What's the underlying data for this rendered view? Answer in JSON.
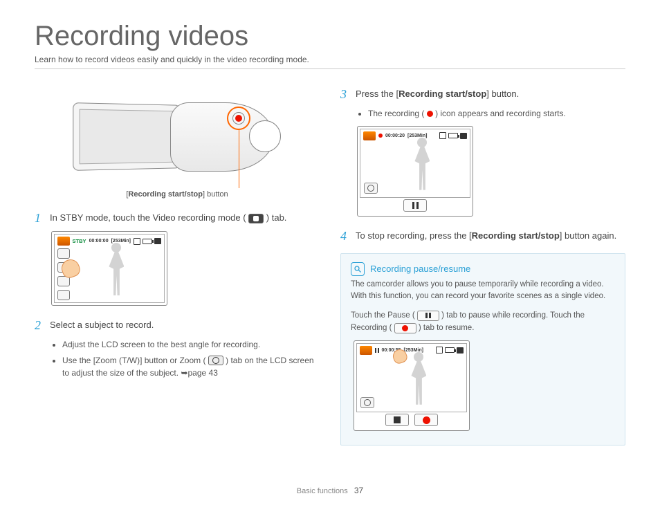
{
  "header": {
    "title": "Recording videos",
    "subtitle": "Learn how to record videos easily and quickly in the video recording mode."
  },
  "camcorder_caption": {
    "prefix": "[",
    "label": "Recording start/stop",
    "suffix": "] button"
  },
  "steps": {
    "s1": {
      "num": "1",
      "text_before": "In STBY mode, touch the Video recording mode (",
      "text_after": ") tab."
    },
    "s2": {
      "num": "2",
      "text": "Select a subject to record."
    },
    "s2_bullets": {
      "b1": "Adjust the LCD screen to the best angle for recording.",
      "b2_a": "Use the [",
      "b2_b": "Zoom",
      "b2_c": " (",
      "b2_d": "T",
      "b2_e": "/",
      "b2_f": "W",
      "b2_g": ")] button or Zoom (",
      "b2_h": ") tab on the LCD screen to adjust the size of the subject. ",
      "b2_i": "page 43"
    },
    "s3": {
      "num": "3",
      "text_before": "Press the [",
      "label": "Recording start/stop",
      "text_after": "] button."
    },
    "s3_bullet": {
      "a": "The recording (",
      "b": ") icon appears and recording starts."
    },
    "s4": {
      "num": "4",
      "text_before": "To stop recording, press the [",
      "label": "Recording start/stop",
      "text_after": "] button again."
    }
  },
  "lcd": {
    "shot1": {
      "status": "STBY",
      "time": "00:00:00",
      "remaining": "[253Min]"
    },
    "shot2": {
      "time": "00:00:20",
      "remaining": "[253Min]"
    },
    "shot3": {
      "time": "00:00:55",
      "remaining": "[253Min]"
    }
  },
  "infobox": {
    "title": "Recording pause/resume",
    "body": "The camcorder allows you to pause temporarily while recording a video. With this function, you can record your favorite scenes as a single video.",
    "sub_a": "Touch the Pause (",
    "sub_b": ") tab to pause while recording. Touch the Recording (",
    "sub_c": ") tab to resume."
  },
  "footer": {
    "section": "Basic functions",
    "page": "37"
  }
}
